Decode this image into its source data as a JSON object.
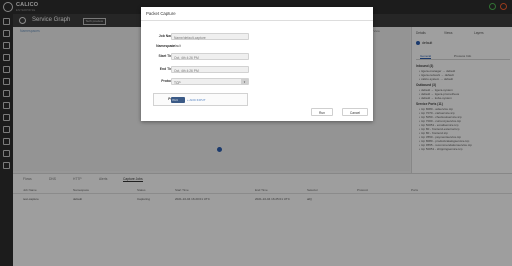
{
  "brand": {
    "name": "CALICO",
    "sub": "ENTERPRISE"
  },
  "page": {
    "title": "Service Graph",
    "badge": "Tech preview"
  },
  "breadcrumb": "Namespaces",
  "graph": {
    "top_right_text": "Summary / View"
  },
  "details": {
    "tabs": [
      "Details",
      "Views",
      "Layers"
    ],
    "node_name": "default",
    "subtabs": [
      "General",
      "Process Info"
    ],
    "sections": {
      "inbound": "Inbound (3)",
      "outbound": "Outbound (3)",
      "service_ports": "Service Ports (11)"
    },
    "inbound": [
      "tigera-manager → default",
      "tigera-network → default",
      "calico-system → default"
    ],
    "outbound": [
      "default → tigera-system",
      "default → tigera-prometheus",
      "default → kube-system"
    ],
    "ports": [
      "tcp 8080 - adservice.tcp",
      "tcp 7070 - cartservice.tcp",
      "tcp 5050 - checkoutservice.tcp",
      "tcp 7000 - currencyservice.tcp",
      "tcp 50051 - emailservice.tcp",
      "tcp 80 - frontend-external.tcp",
      "tcp 80 - frontend.tcp",
      "tcp 3550 - paymentservice.tcp",
      "tcp 8080 - productcatalogservice.tcp",
      "tcp 9555 - recommendationservice.tcp",
      "tcp 50051 - shippingservice.tcp"
    ]
  },
  "bottom": {
    "tabs": [
      "Flows",
      "DNS",
      "HTTP",
      "Alerts",
      "Capture Jobs"
    ],
    "active_tab": "Capture Jobs",
    "columns": [
      "Job Name",
      "Namespace",
      "Status",
      "Start Time",
      "End Time",
      "Selector",
      "Protocol",
      "Ports"
    ],
    "rows": [
      {
        "name": "test-capture",
        "namespace": "default",
        "status": "Capturing",
        "start": "2021-10-04 16:20:01 UTC",
        "end": "2021-10-04 16:25:01 UTC",
        "selector": "all()",
        "protocol": "",
        "ports": ""
      }
    ]
  },
  "modal": {
    "title": "Packet Capture",
    "job_name_label": "Job Name",
    "job_name_placeholder": "Name/default-capture",
    "namespace_label": "Namespace",
    "namespace_value": "default",
    "start_label": "Start Time",
    "start_value": "Oct, 4th 4:26 PM",
    "end_label": "End Time",
    "end_value": "Oct, 4th 4:26 PM",
    "protocol_label": "Protocol",
    "protocol_value": "TCP",
    "port_label": "Port",
    "port_value": "Port",
    "add_input_label": "+ ADD INPUT",
    "run_label": "Run",
    "cancel_label": "Cancel"
  },
  "colors": {
    "topbar": "#2b2b2b",
    "accent": "#2a5aa8",
    "ok": "#4caf50",
    "warn": "#e65a2b"
  }
}
